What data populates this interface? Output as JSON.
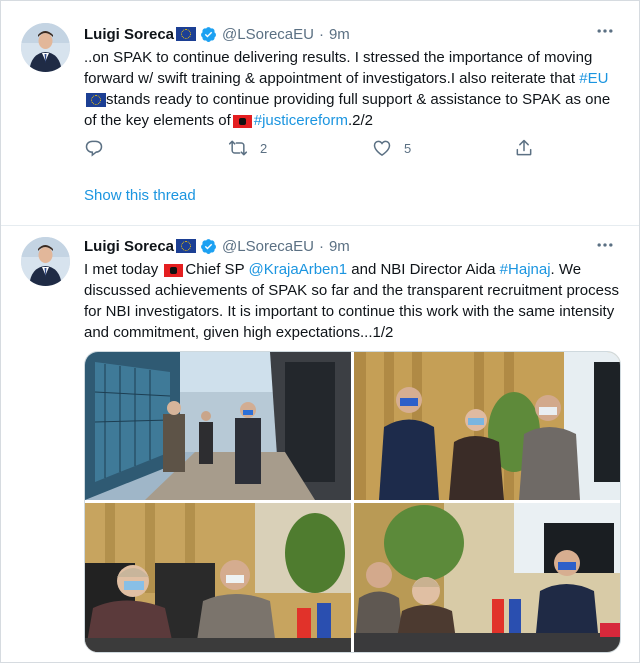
{
  "tweets": [
    {
      "author_name": "Luigi Soreca",
      "handle": "@LSorecaEU",
      "separator": "·",
      "time": "9m",
      "text_parts": {
        "p1": "..on SPAK to continue delivering results. I stressed the importance of moving forward w/ swift training & appointment of investigators.I also reiterate that ",
        "hashtag_eu": "#EU",
        "p2": "stands ready to continue providing full support & assistance to SPAK as one of the key elements of",
        "hashtag_justice": "#justicereform",
        "p3": ".2/2"
      },
      "actions": {
        "reply_count": "",
        "retweet_count": "2",
        "like_count": "5"
      },
      "show_thread": "Show this thread"
    },
    {
      "author_name": "Luigi Soreca",
      "handle": "@LSorecaEU",
      "separator": "·",
      "time": "9m",
      "text_parts": {
        "p1": "I met today ",
        "p2": "Chief SP ",
        "mention": "@KrajaArben1",
        "p3": " and NBI Director Aida ",
        "hashtag": "#Hajnaj",
        "p4": ". We discussed achievements of SPAK so far and the transparent recruitment process for NBI investigators. It is important to continue this work with the same intensity and commitment, given high expectations...1/2"
      }
    }
  ],
  "icons": {
    "more": "more-horizontal-icon",
    "reply": "reply-icon",
    "retweet": "retweet-icon",
    "like": "heart-icon",
    "share": "share-icon",
    "verified": "verified-badge-icon"
  },
  "colors": {
    "link": "#1b95e0",
    "secondary_text": "#5b7083",
    "verified": "#1da1f2"
  }
}
